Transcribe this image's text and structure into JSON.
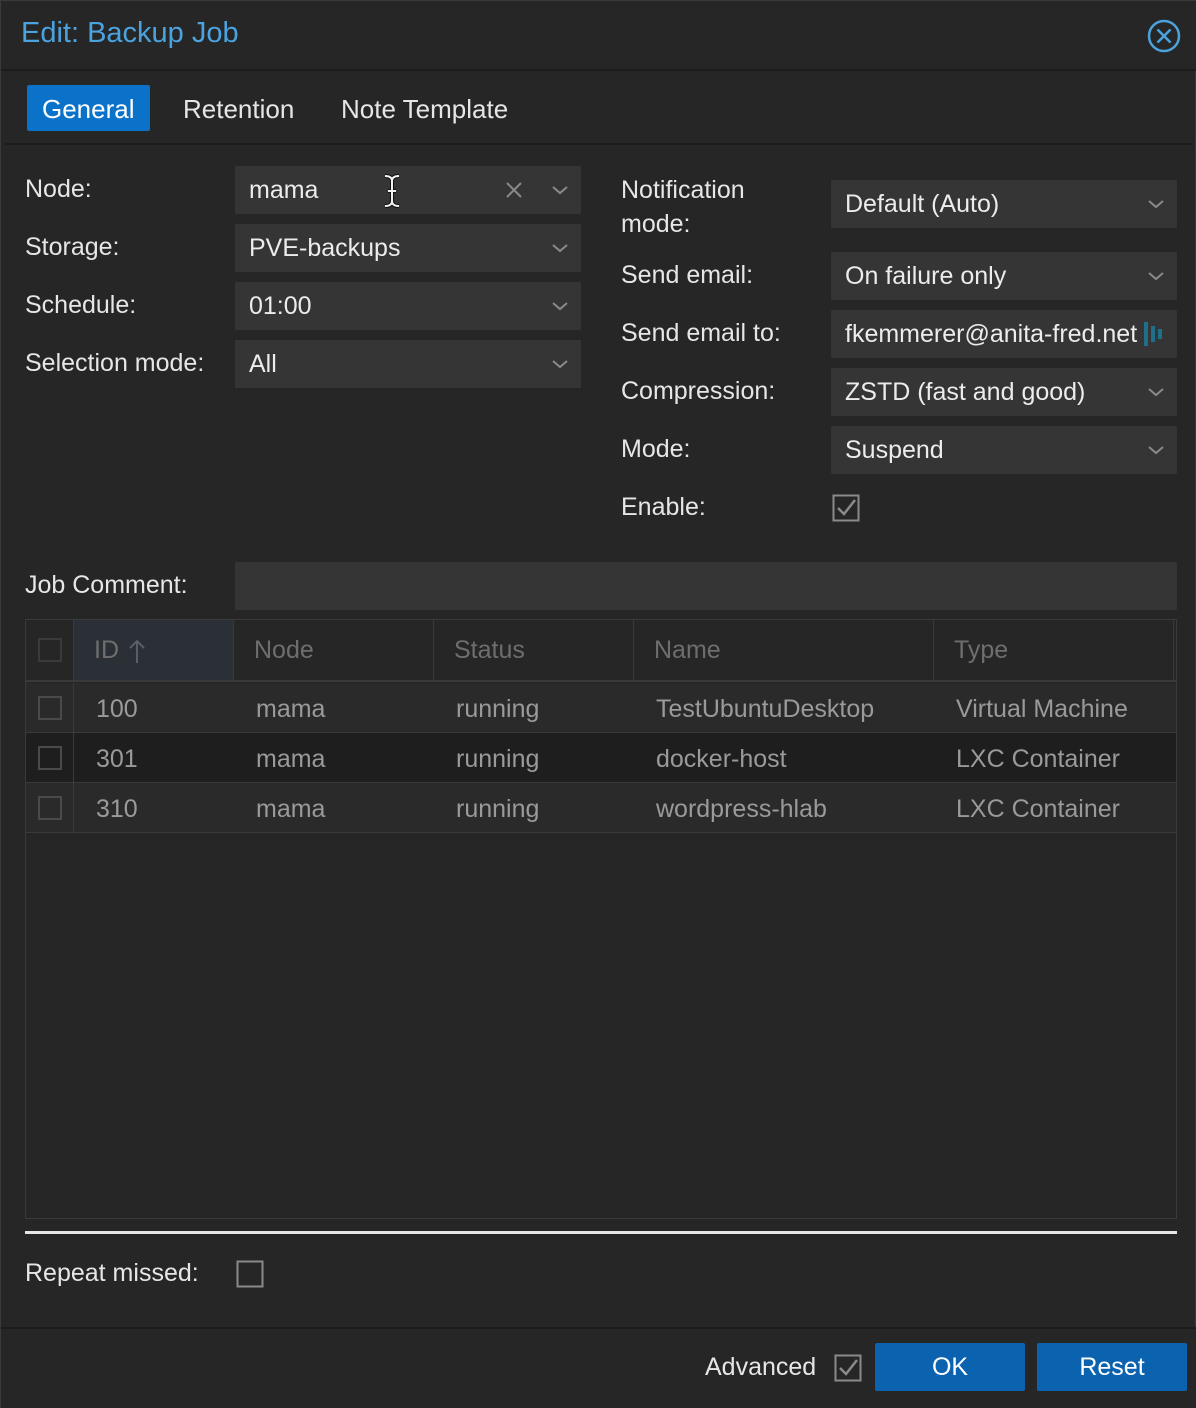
{
  "window": {
    "title": "Edit: Backup Job",
    "close_icon": "close-circle-icon"
  },
  "tabs": [
    {
      "label": "General",
      "active": true
    },
    {
      "label": "Retention",
      "active": false
    },
    {
      "label": "Note Template",
      "active": false
    }
  ],
  "left_form": {
    "node": {
      "label": "Node:",
      "value": "mama"
    },
    "storage": {
      "label": "Storage:",
      "value": "PVE-backups"
    },
    "schedule": {
      "label": "Schedule:",
      "value": "01:00"
    },
    "selection_mode": {
      "label": "Selection mode:",
      "value": "All"
    }
  },
  "right_form": {
    "notification_mode": {
      "label": "Notification mode:",
      "value": "Default (Auto)"
    },
    "send_email": {
      "label": "Send email:",
      "value": "On failure only"
    },
    "send_email_to": {
      "label": "Send email to:",
      "value": "fkemmerer@anita-fred.net"
    },
    "compression": {
      "label": "Compression:",
      "value": "ZSTD (fast and good)"
    },
    "mode": {
      "label": "Mode:",
      "value": "Suspend"
    },
    "enable": {
      "label": "Enable:",
      "checked": true
    }
  },
  "job_comment": {
    "label": "Job Comment:",
    "value": ""
  },
  "grid": {
    "columns": [
      "ID",
      "Node",
      "Status",
      "Name",
      "Type"
    ],
    "sort_column": "ID",
    "sort_direction": "ascending",
    "rows": [
      {
        "id": "100",
        "node": "mama",
        "status": "running",
        "name": "TestUbuntuDesktop",
        "type": "Virtual Machine"
      },
      {
        "id": "301",
        "node": "mama",
        "status": "running",
        "name": "docker-host",
        "type": "LXC Container"
      },
      {
        "id": "310",
        "node": "mama",
        "status": "running",
        "name": "wordpress-hlab",
        "type": "LXC Container"
      }
    ]
  },
  "repeat_missed": {
    "label": "Repeat missed:",
    "checked": false
  },
  "footer": {
    "advanced_label": "Advanced",
    "advanced_checked": true,
    "ok_label": "OK",
    "reset_label": "Reset"
  },
  "colors": {
    "accent": "#0b72c9",
    "title": "#4aa3df",
    "background": "#262626",
    "field": "#353535"
  }
}
